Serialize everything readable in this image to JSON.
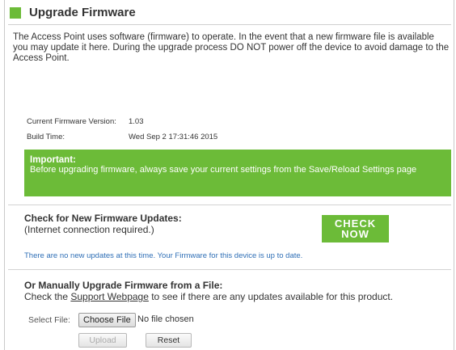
{
  "header": {
    "title": "Upgrade Firmware"
  },
  "intro": "The Access Point uses software (firmware) to operate. In the event that a new firmware file is available you may update it here. During the upgrade process DO NOT power off the device to avoid damage to the Access Point.",
  "info": {
    "version_label": "Current Firmware Version:",
    "version_value": "1.03",
    "build_label": "Build Time:",
    "build_value": "Wed Sep 2 17:31:46 2015"
  },
  "important": {
    "title": "Important:",
    "text": "Before upgrading firmware, always save your current settings from the Save/Reload Settings page"
  },
  "check": {
    "title": "Check for New Firmware Updates:",
    "subtitle": "(Internet connection required.)",
    "button_line1": "CHECK",
    "button_line2": "NOW",
    "status": "There are no new updates at this time. Your Firmware for this device is up to date."
  },
  "manual": {
    "title": "Or Manually Upgrade Firmware from a File:",
    "sub_before": "Check the ",
    "link": "Support Webpage",
    "sub_after": " to see if there are any updates available for this product.",
    "select_label": "Select File:",
    "choose_label": "Choose File",
    "no_file": "No file chosen",
    "upload_label": "Upload",
    "reset_label": "Reset"
  },
  "colors": {
    "accent": "#6cbb38",
    "link": "#2f6fb6"
  }
}
